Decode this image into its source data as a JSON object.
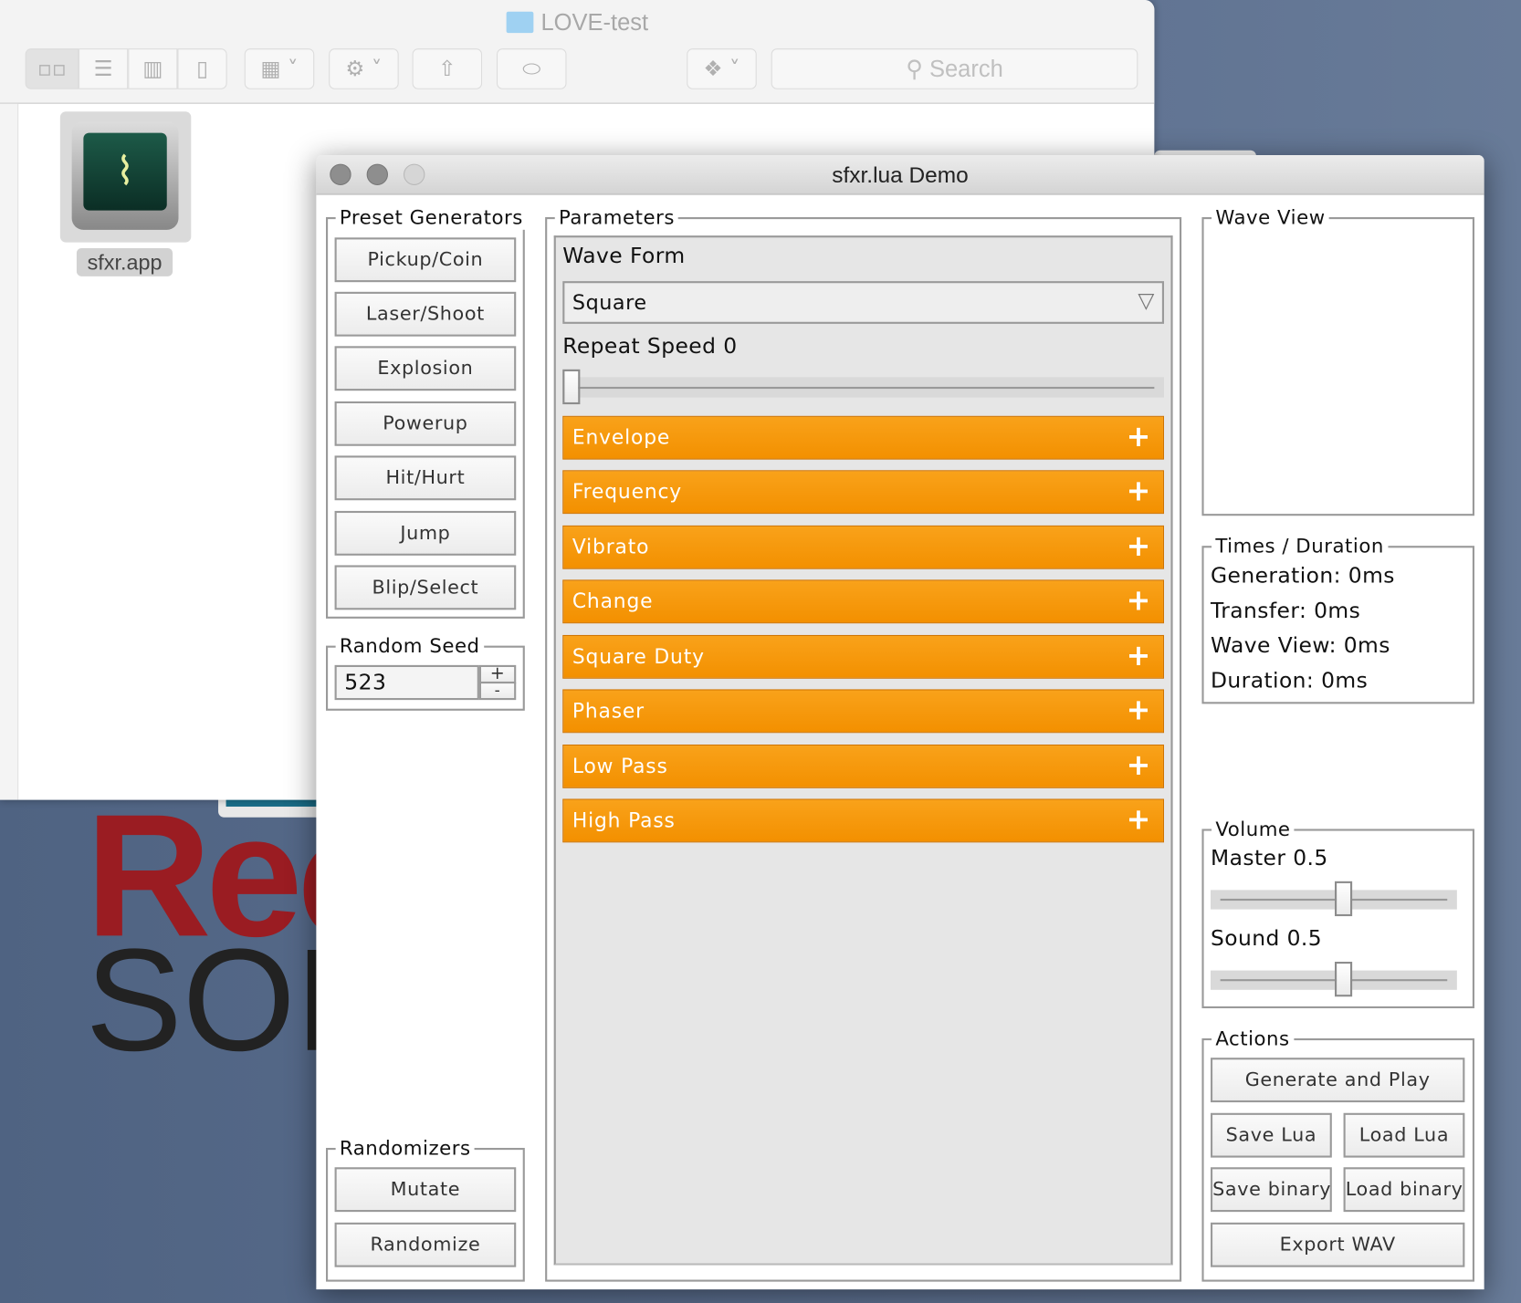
{
  "finder": {
    "title": "LOVE-test",
    "search_placeholder": "Search",
    "file_label": "sfxr.app"
  },
  "desktop": {
    "logo_line1": "Rec",
    "logo_line2": "SOF"
  },
  "window": {
    "title": "sfxr.lua Demo"
  },
  "presets": {
    "legend": "Preset Generators",
    "buttons": [
      "Pickup/Coin",
      "Laser/Shoot",
      "Explosion",
      "Powerup",
      "Hit/Hurt",
      "Jump",
      "Blip/Select"
    ]
  },
  "seed": {
    "legend": "Random Seed",
    "value": "523",
    "inc": "+",
    "dec": "-"
  },
  "randomizers": {
    "legend": "Randomizers",
    "mutate": "Mutate",
    "randomize": "Randomize"
  },
  "parameters": {
    "legend": "Parameters",
    "waveform_label": "Wave Form",
    "waveform_value": "Square",
    "repeat_label": "Repeat Speed 0",
    "repeat_value": 0,
    "sections": [
      "Envelope",
      "Frequency",
      "Vibrato",
      "Change",
      "Square Duty",
      "Phaser",
      "Low Pass",
      "High Pass"
    ],
    "expand_symbol": "+",
    "accent": "#f39000"
  },
  "waveview": {
    "legend": "Wave View"
  },
  "times": {
    "legend": "Times / Duration",
    "lines": [
      "Generation: 0ms",
      "Transfer: 0ms",
      "Wave View: 0ms",
      "Duration: 0ms"
    ]
  },
  "volume": {
    "legend": "Volume",
    "master_label": "Master 0.5",
    "master": 0.5,
    "sound_label": "Sound 0.5",
    "sound": 0.5
  },
  "actions": {
    "legend": "Actions",
    "generate": "Generate and Play",
    "save_lua": "Save Lua",
    "load_lua": "Load Lua",
    "save_binary": "Save binary",
    "load_binary": "Load binary",
    "export_wav": "Export WAV"
  }
}
